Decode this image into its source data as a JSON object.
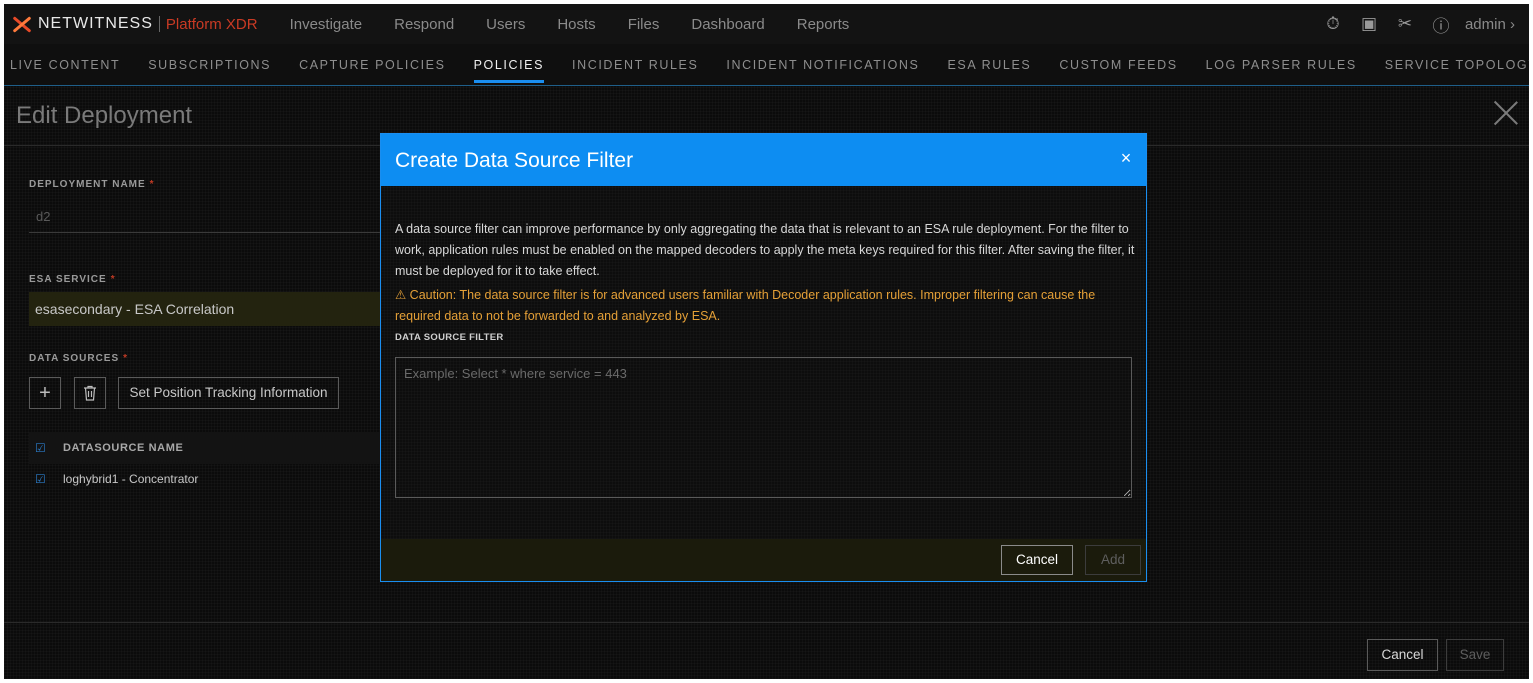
{
  "brand": {
    "name": "NETWITNESS",
    "product": "Platform XDR"
  },
  "nav": [
    "Investigate",
    "Respond",
    "Users",
    "Hosts",
    "Files",
    "Dashboard",
    "Reports"
  ],
  "top_icons": {
    "timer": "stopwatch-icon",
    "reports": "report-icon",
    "tools": "tools-icon",
    "help": "help-icon"
  },
  "user": {
    "label": "admin"
  },
  "subtabs": [
    "LIVE CONTENT",
    "SUBSCRIPTIONS",
    "CAPTURE POLICIES",
    "POLICIES",
    "INCIDENT RULES",
    "INCIDENT NOTIFICATIONS",
    "ESA RULES",
    "CUSTOM FEEDS",
    "LOG PARSER RULES",
    "SERVICE TOPOLOGY"
  ],
  "active_subtab": "POLICIES",
  "page": {
    "title": "Edit Deployment",
    "deployment_name_label": "DEPLOYMENT NAME",
    "deployment_name_value": "d2",
    "esa_service_label": "ESA SERVICE",
    "esa_service_value": "esasecondary - ESA Correlation",
    "data_sources_label": "DATA SOURCES",
    "required_mark": "*",
    "add_icon": "+",
    "set_position_label": "Set Position Tracking Information",
    "table_header": "DATASOURCE NAME",
    "rows": [
      "loghybrid1 - Concentrator"
    ],
    "cancel_label": "Cancel",
    "save_label": "Save"
  },
  "modal": {
    "title": "Create Data Source Filter",
    "close": "×",
    "intro": "A data source filter can improve performance by only aggregating the data that is relevant to an ESA rule deployment. For the filter to work, application rules must be enabled on the mapped decoders to apply the meta keys required for this filter. After saving the filter, it must be deployed for it to take effect.",
    "caution": "⚠ Caution: The data source filter is for advanced users familiar with Decoder application rules. Improper filtering can cause the required data to not be forwarded to and analyzed by ESA.",
    "filter_label": "DATA SOURCE FILTER",
    "filter_placeholder": "Example: Select * where service = 443",
    "cancel_label": "Cancel",
    "add_label": "Add"
  },
  "colors": {
    "accent": "#0d8df2",
    "caution": "#e5a037",
    "required": "#c03a24",
    "brand_red": "#c93a24"
  }
}
